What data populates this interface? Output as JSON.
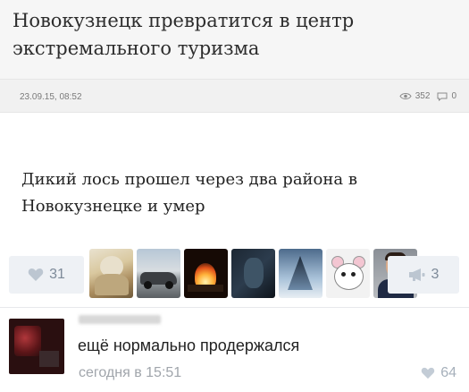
{
  "article": {
    "headline": "Новокузнецк превратится в центр экстремального туризма",
    "date": "23.09.15, 08:52",
    "views": "352",
    "comments": "0"
  },
  "post": {
    "text": "Дикий лось прошел через два района в Новокузнецке и умер",
    "likes": "31",
    "shares": "3",
    "likers": [
      {
        "name": "liker-avatar-monkey"
      },
      {
        "name": "liker-avatar-car"
      },
      {
        "name": "liker-avatar-fire"
      },
      {
        "name": "liker-avatar-dark"
      },
      {
        "name": "liker-avatar-anime"
      },
      {
        "name": "liker-avatar-cartoon"
      },
      {
        "name": "liker-avatar-man"
      }
    ]
  },
  "comment": {
    "text": "ещё нормально продержался",
    "time": "сегодня в 15:51",
    "likes": "64"
  },
  "icons": {
    "views": "eye-icon",
    "comments": "comment-icon",
    "like": "heart-icon",
    "share": "megaphone-icon"
  },
  "colors": {
    "action_bg": "#eef1f5",
    "action_text": "#7d8a99",
    "muted_text": "#a0a5ab"
  }
}
